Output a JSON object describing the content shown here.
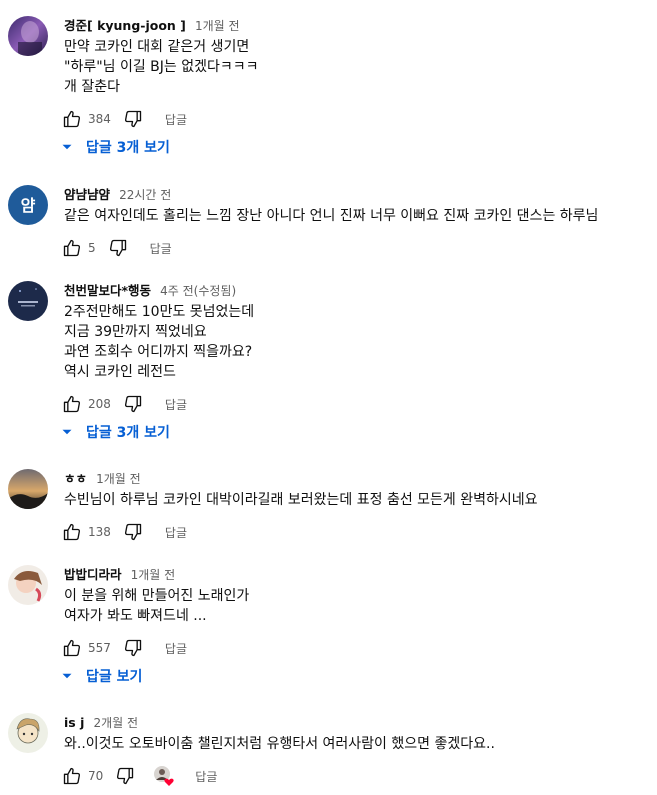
{
  "comments": [
    {
      "author": "경준[ kyung-joon ]",
      "time": "1개월 전",
      "lines": [
        "만약 코카인 대회 같은거 생기면",
        "\"하루\"님 이길 BJ는 없겠다ㅋㅋㅋ",
        "개 잘춘다"
      ],
      "likes": "384",
      "reply_label": "답글",
      "replies_label": "답글 3개 보기"
    },
    {
      "author": "얌냠냠얌",
      "time": "22시간 전",
      "avatar_text": "얌",
      "avatar_color": "#1f5b9a",
      "lines": [
        "같은 여자인데도 홀리는 느낌 장난 아니다 언니 진짜 너무 이뻐요 진짜 코카인 댄스는 하루님"
      ],
      "likes": "5",
      "reply_label": "답글"
    },
    {
      "author": "천번말보다*행동",
      "time": "4주 전(수정됨)",
      "lines": [
        "2주전만해도 10만도 못넘었는데",
        "지금 39만까지 찍었네요",
        "과연 조회수 어디까지 찍을까요?",
        "역시 코카인 레전드"
      ],
      "likes": "208",
      "reply_label": "답글",
      "replies_label": "답글 3개 보기"
    },
    {
      "author": "ㅎㅎ",
      "time": "1개월 전",
      "lines": [
        "수빈님이 하루님 코카인 대박이라길래 보러왔는데  표정 춤선 모든게 완벽하시네요"
      ],
      "likes": "138",
      "reply_label": "답글"
    },
    {
      "author": "밥밥디라라",
      "time": "1개월 전",
      "lines": [
        "이 분을 위해 만들어진 노래인가",
        "여자가 봐도 빠져드네 ..."
      ],
      "likes": "557",
      "reply_label": "답글",
      "replies_label": "답글 보기"
    },
    {
      "author": "is j",
      "time": "2개월 전",
      "lines": [
        "와..이것도 오토바이춤 챌린지처럼 유행타서 여러사람이 했으면 좋겠다요.."
      ],
      "likes": "70",
      "reply_label": "답글"
    }
  ],
  "icons": {
    "like": "thumb-up-icon",
    "dislike": "thumb-down-icon",
    "expand": "caret-down-icon",
    "creator_heart": "creator-heart-icon"
  },
  "colors": {
    "link_blue": "#065fd4",
    "secondary_text": "#606060",
    "heart_red": "#ff0033"
  }
}
